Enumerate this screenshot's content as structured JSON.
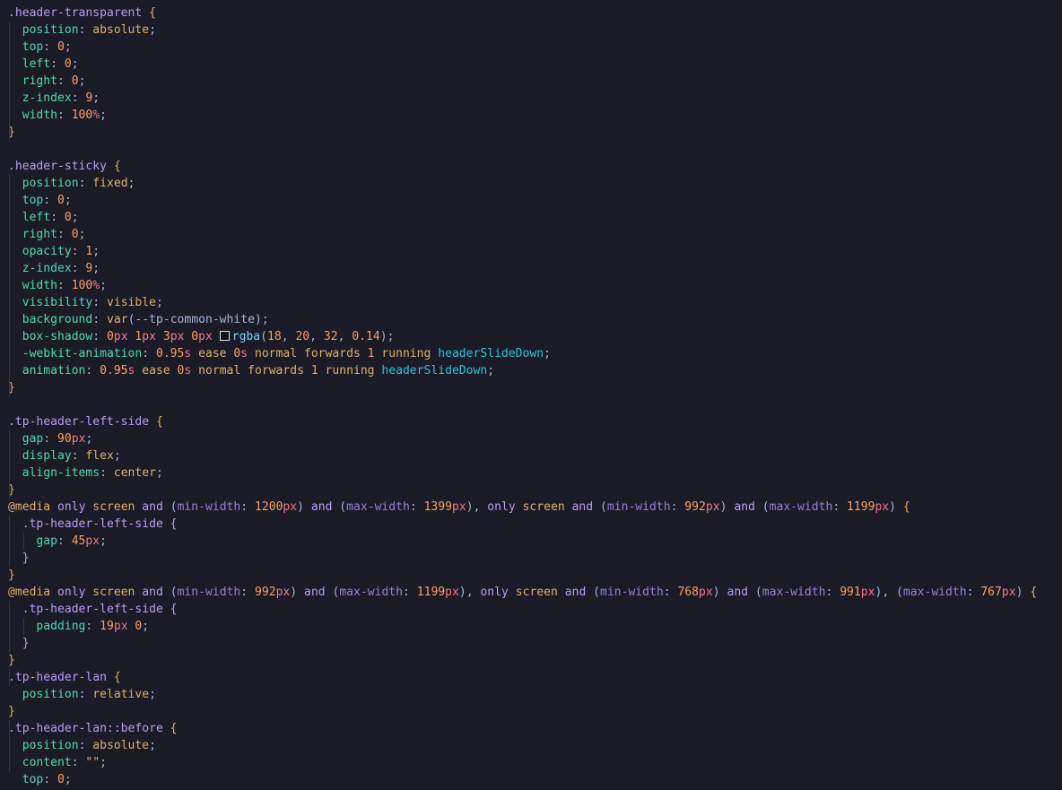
{
  "colors": {
    "background": "#1a1b26",
    "selector": "#bb9af7",
    "property": "#4fd6be",
    "punct": "#a9b1d6",
    "brace1": "#e0af68",
    "brace2": "#bb9af7",
    "keyword_value": "#ff9e64",
    "value": "#e0af68",
    "number": "#ff9e64",
    "unit": "#f7768e",
    "function": "#7dcfff",
    "at_rule": "#e0af68",
    "media_keyword": "#bb9af7",
    "media_feature": "#9d7cd8",
    "identifier": "#2ac3de",
    "string": "#e0af68",
    "indent_guide": "#33364a"
  },
  "code_lines": [
    [
      {
        "t": ".header-transparent",
        "c": "selector"
      },
      {
        "t": " ",
        "c": "punct"
      },
      {
        "t": "{",
        "c": "brace1"
      }
    ],
    [
      {
        "t": "  position",
        "c": "property"
      },
      {
        "t": ": ",
        "c": "punct"
      },
      {
        "t": "absolute",
        "c": "value"
      },
      {
        "t": ";",
        "c": "punct"
      }
    ],
    [
      {
        "t": "  top",
        "c": "property"
      },
      {
        "t": ": ",
        "c": "punct"
      },
      {
        "t": "0",
        "c": "number"
      },
      {
        "t": ";",
        "c": "punct"
      }
    ],
    [
      {
        "t": "  left",
        "c": "property"
      },
      {
        "t": ": ",
        "c": "punct"
      },
      {
        "t": "0",
        "c": "number"
      },
      {
        "t": ";",
        "c": "punct"
      }
    ],
    [
      {
        "t": "  right",
        "c": "property"
      },
      {
        "t": ": ",
        "c": "punct"
      },
      {
        "t": "0",
        "c": "number"
      },
      {
        "t": ";",
        "c": "punct"
      }
    ],
    [
      {
        "t": "  z-index",
        "c": "property"
      },
      {
        "t": ": ",
        "c": "punct"
      },
      {
        "t": "9",
        "c": "number"
      },
      {
        "t": ";",
        "c": "punct"
      }
    ],
    [
      {
        "t": "  width",
        "c": "property"
      },
      {
        "t": ": ",
        "c": "punct"
      },
      {
        "t": "100",
        "c": "number"
      },
      {
        "t": "%",
        "c": "unit"
      },
      {
        "t": ";",
        "c": "punct"
      }
    ],
    [
      {
        "t": "}",
        "c": "brace1"
      }
    ],
    [],
    [
      {
        "t": ".header-sticky",
        "c": "selector"
      },
      {
        "t": " ",
        "c": "punct"
      },
      {
        "t": "{",
        "c": "brace1"
      }
    ],
    [
      {
        "t": "  position",
        "c": "property"
      },
      {
        "t": ": ",
        "c": "punct"
      },
      {
        "t": "fixed",
        "c": "value"
      },
      {
        "t": ";",
        "c": "punct"
      }
    ],
    [
      {
        "t": "  top",
        "c": "property"
      },
      {
        "t": ": ",
        "c": "punct"
      },
      {
        "t": "0",
        "c": "number"
      },
      {
        "t": ";",
        "c": "punct"
      }
    ],
    [
      {
        "t": "  left",
        "c": "property"
      },
      {
        "t": ": ",
        "c": "punct"
      },
      {
        "t": "0",
        "c": "number"
      },
      {
        "t": ";",
        "c": "punct"
      }
    ],
    [
      {
        "t": "  right",
        "c": "property"
      },
      {
        "t": ": ",
        "c": "punct"
      },
      {
        "t": "0",
        "c": "number"
      },
      {
        "t": ";",
        "c": "punct"
      }
    ],
    [
      {
        "t": "  opacity",
        "c": "property"
      },
      {
        "t": ": ",
        "c": "punct"
      },
      {
        "t": "1",
        "c": "number"
      },
      {
        "t": ";",
        "c": "punct"
      }
    ],
    [
      {
        "t": "  z-index",
        "c": "property"
      },
      {
        "t": ": ",
        "c": "punct"
      },
      {
        "t": "9",
        "c": "number"
      },
      {
        "t": ";",
        "c": "punct"
      }
    ],
    [
      {
        "t": "  width",
        "c": "property"
      },
      {
        "t": ": ",
        "c": "punct"
      },
      {
        "t": "100",
        "c": "number"
      },
      {
        "t": "%",
        "c": "unit"
      },
      {
        "t": ";",
        "c": "punct"
      }
    ],
    [
      {
        "t": "  visibility",
        "c": "property"
      },
      {
        "t": ": ",
        "c": "punct"
      },
      {
        "t": "visible",
        "c": "value"
      },
      {
        "t": ";",
        "c": "punct"
      }
    ],
    [
      {
        "t": "  background",
        "c": "property"
      },
      {
        "t": ": ",
        "c": "punct"
      },
      {
        "t": "var",
        "c": "value"
      },
      {
        "t": "(",
        "c": "punct"
      },
      {
        "t": "--tp-common-white",
        "c": "punct"
      },
      {
        "t": ");",
        "c": "punct"
      }
    ],
    [
      {
        "t": "  box-shadow",
        "c": "property"
      },
      {
        "t": ": ",
        "c": "punct"
      },
      {
        "t": "0",
        "c": "number"
      },
      {
        "t": "px",
        "c": "unit"
      },
      {
        "t": " ",
        "c": "punct"
      },
      {
        "t": "1",
        "c": "number"
      },
      {
        "t": "px",
        "c": "unit"
      },
      {
        "t": " ",
        "c": "punct"
      },
      {
        "t": "3",
        "c": "number"
      },
      {
        "t": "px",
        "c": "unit"
      },
      {
        "t": " ",
        "c": "punct"
      },
      {
        "t": "0",
        "c": "number"
      },
      {
        "t": "px",
        "c": "unit"
      },
      {
        "t": " ",
        "c": "punct"
      },
      {
        "swatch": true
      },
      {
        "t": "rgba",
        "c": "function"
      },
      {
        "t": "(",
        "c": "punct"
      },
      {
        "t": "18",
        "c": "number"
      },
      {
        "t": ", ",
        "c": "punct"
      },
      {
        "t": "20",
        "c": "number"
      },
      {
        "t": ", ",
        "c": "punct"
      },
      {
        "t": "32",
        "c": "number"
      },
      {
        "t": ", ",
        "c": "punct"
      },
      {
        "t": "0.14",
        "c": "number"
      },
      {
        "t": ");",
        "c": "punct"
      }
    ],
    [
      {
        "t": "  -webkit-animation",
        "c": "property"
      },
      {
        "t": ": ",
        "c": "punct"
      },
      {
        "t": "0.95",
        "c": "number"
      },
      {
        "t": "s",
        "c": "unit"
      },
      {
        "t": " ",
        "c": "punct"
      },
      {
        "t": "ease",
        "c": "value"
      },
      {
        "t": " ",
        "c": "punct"
      },
      {
        "t": "0",
        "c": "number"
      },
      {
        "t": "s",
        "c": "unit"
      },
      {
        "t": " ",
        "c": "punct"
      },
      {
        "t": "normal",
        "c": "value"
      },
      {
        "t": " ",
        "c": "punct"
      },
      {
        "t": "forwards",
        "c": "value"
      },
      {
        "t": " ",
        "c": "punct"
      },
      {
        "t": "1",
        "c": "number"
      },
      {
        "t": " ",
        "c": "punct"
      },
      {
        "t": "running",
        "c": "value"
      },
      {
        "t": " ",
        "c": "punct"
      },
      {
        "t": "headerSlideDown",
        "c": "identifier"
      },
      {
        "t": ";",
        "c": "punct"
      }
    ],
    [
      {
        "t": "  animation",
        "c": "property"
      },
      {
        "t": ": ",
        "c": "punct"
      },
      {
        "t": "0.95",
        "c": "number"
      },
      {
        "t": "s",
        "c": "unit"
      },
      {
        "t": " ",
        "c": "punct"
      },
      {
        "t": "ease",
        "c": "value"
      },
      {
        "t": " ",
        "c": "punct"
      },
      {
        "t": "0",
        "c": "number"
      },
      {
        "t": "s",
        "c": "unit"
      },
      {
        "t": " ",
        "c": "punct"
      },
      {
        "t": "normal",
        "c": "value"
      },
      {
        "t": " ",
        "c": "punct"
      },
      {
        "t": "forwards",
        "c": "value"
      },
      {
        "t": " ",
        "c": "punct"
      },
      {
        "t": "1",
        "c": "number"
      },
      {
        "t": " ",
        "c": "punct"
      },
      {
        "t": "running",
        "c": "value"
      },
      {
        "t": " ",
        "c": "punct"
      },
      {
        "t": "headerSlideDown",
        "c": "identifier"
      },
      {
        "t": ";",
        "c": "punct"
      }
    ],
    [
      {
        "t": "}",
        "c": "brace1"
      }
    ],
    [],
    [
      {
        "t": ".tp-header-left-side",
        "c": "selector"
      },
      {
        "t": " ",
        "c": "punct"
      },
      {
        "t": "{",
        "c": "brace1"
      }
    ],
    [
      {
        "t": "  gap",
        "c": "property"
      },
      {
        "t": ": ",
        "c": "punct"
      },
      {
        "t": "90",
        "c": "number"
      },
      {
        "t": "px",
        "c": "unit"
      },
      {
        "t": ";",
        "c": "punct"
      }
    ],
    [
      {
        "t": "  display",
        "c": "property"
      },
      {
        "t": ": ",
        "c": "punct"
      },
      {
        "t": "flex",
        "c": "value"
      },
      {
        "t": ";",
        "c": "punct"
      }
    ],
    [
      {
        "t": "  align-items",
        "c": "property"
      },
      {
        "t": ": ",
        "c": "punct"
      },
      {
        "t": "center",
        "c": "value"
      },
      {
        "t": ";",
        "c": "punct"
      }
    ],
    [
      {
        "t": "}",
        "c": "brace1"
      }
    ],
    [
      {
        "t": "@media",
        "c": "at_rule"
      },
      {
        "t": " ",
        "c": "punct"
      },
      {
        "t": "only",
        "c": "media_keyword"
      },
      {
        "t": " ",
        "c": "punct"
      },
      {
        "t": "screen",
        "c": "value"
      },
      {
        "t": " ",
        "c": "punct"
      },
      {
        "t": "and",
        "c": "media_keyword"
      },
      {
        "t": " (",
        "c": "punct"
      },
      {
        "t": "min-width",
        "c": "media_feature"
      },
      {
        "t": ": ",
        "c": "punct"
      },
      {
        "t": "1200",
        "c": "number"
      },
      {
        "t": "px",
        "c": "unit"
      },
      {
        "t": ") ",
        "c": "punct"
      },
      {
        "t": "and",
        "c": "media_keyword"
      },
      {
        "t": " (",
        "c": "punct"
      },
      {
        "t": "max-width",
        "c": "media_feature"
      },
      {
        "t": ": ",
        "c": "punct"
      },
      {
        "t": "1399",
        "c": "number"
      },
      {
        "t": "px",
        "c": "unit"
      },
      {
        "t": "), ",
        "c": "punct"
      },
      {
        "t": "only",
        "c": "media_keyword"
      },
      {
        "t": " ",
        "c": "punct"
      },
      {
        "t": "screen",
        "c": "value"
      },
      {
        "t": " ",
        "c": "punct"
      },
      {
        "t": "and",
        "c": "media_keyword"
      },
      {
        "t": " (",
        "c": "punct"
      },
      {
        "t": "min-width",
        "c": "media_feature"
      },
      {
        "t": ": ",
        "c": "punct"
      },
      {
        "t": "992",
        "c": "number"
      },
      {
        "t": "px",
        "c": "unit"
      },
      {
        "t": ") ",
        "c": "punct"
      },
      {
        "t": "and",
        "c": "media_keyword"
      },
      {
        "t": " (",
        "c": "punct"
      },
      {
        "t": "max-width",
        "c": "media_feature"
      },
      {
        "t": ": ",
        "c": "punct"
      },
      {
        "t": "1199",
        "c": "number"
      },
      {
        "t": "px",
        "c": "unit"
      },
      {
        "t": ") ",
        "c": "punct"
      },
      {
        "t": "{",
        "c": "brace1"
      }
    ],
    [
      {
        "t": "  .tp-header-left-side",
        "c": "selector"
      },
      {
        "t": " ",
        "c": "punct"
      },
      {
        "t": "{",
        "c": "brace2"
      }
    ],
    [
      {
        "t": "    gap",
        "c": "property"
      },
      {
        "t": ": ",
        "c": "punct"
      },
      {
        "t": "45",
        "c": "number"
      },
      {
        "t": "px",
        "c": "unit"
      },
      {
        "t": ";",
        "c": "punct"
      }
    ],
    [
      {
        "t": "  }",
        "c": "brace2"
      }
    ],
    [
      {
        "t": "}",
        "c": "brace1"
      }
    ],
    [
      {
        "t": "@media",
        "c": "at_rule"
      },
      {
        "t": " ",
        "c": "punct"
      },
      {
        "t": "only",
        "c": "media_keyword"
      },
      {
        "t": " ",
        "c": "punct"
      },
      {
        "t": "screen",
        "c": "value"
      },
      {
        "t": " ",
        "c": "punct"
      },
      {
        "t": "and",
        "c": "media_keyword"
      },
      {
        "t": " (",
        "c": "punct"
      },
      {
        "t": "min-width",
        "c": "media_feature"
      },
      {
        "t": ": ",
        "c": "punct"
      },
      {
        "t": "992",
        "c": "number"
      },
      {
        "t": "px",
        "c": "unit"
      },
      {
        "t": ") ",
        "c": "punct"
      },
      {
        "t": "and",
        "c": "media_keyword"
      },
      {
        "t": " (",
        "c": "punct"
      },
      {
        "t": "max-width",
        "c": "media_feature"
      },
      {
        "t": ": ",
        "c": "punct"
      },
      {
        "t": "1199",
        "c": "number"
      },
      {
        "t": "px",
        "c": "unit"
      },
      {
        "t": "), ",
        "c": "punct"
      },
      {
        "t": "only",
        "c": "media_keyword"
      },
      {
        "t": " ",
        "c": "punct"
      },
      {
        "t": "screen",
        "c": "value"
      },
      {
        "t": " ",
        "c": "punct"
      },
      {
        "t": "and",
        "c": "media_keyword"
      },
      {
        "t": " (",
        "c": "punct"
      },
      {
        "t": "min-width",
        "c": "media_feature"
      },
      {
        "t": ": ",
        "c": "punct"
      },
      {
        "t": "768",
        "c": "number"
      },
      {
        "t": "px",
        "c": "unit"
      },
      {
        "t": ") ",
        "c": "punct"
      },
      {
        "t": "and",
        "c": "media_keyword"
      },
      {
        "t": " (",
        "c": "punct"
      },
      {
        "t": "max-width",
        "c": "media_feature"
      },
      {
        "t": ": ",
        "c": "punct"
      },
      {
        "t": "991",
        "c": "number"
      },
      {
        "t": "px",
        "c": "unit"
      },
      {
        "t": "), (",
        "c": "punct"
      },
      {
        "t": "max-width",
        "c": "media_feature"
      },
      {
        "t": ": ",
        "c": "punct"
      },
      {
        "t": "767",
        "c": "number"
      },
      {
        "t": "px",
        "c": "unit"
      },
      {
        "t": ") ",
        "c": "punct"
      },
      {
        "t": "{",
        "c": "brace1"
      }
    ],
    [
      {
        "t": "  .tp-header-left-side",
        "c": "selector"
      },
      {
        "t": " ",
        "c": "punct"
      },
      {
        "t": "{",
        "c": "brace2"
      }
    ],
    [
      {
        "t": "    padding",
        "c": "property"
      },
      {
        "t": ": ",
        "c": "punct"
      },
      {
        "t": "19",
        "c": "number"
      },
      {
        "t": "px",
        "c": "unit"
      },
      {
        "t": " ",
        "c": "punct"
      },
      {
        "t": "0",
        "c": "number"
      },
      {
        "t": ";",
        "c": "punct"
      }
    ],
    [
      {
        "t": "  }",
        "c": "brace2"
      }
    ],
    [
      {
        "t": "}",
        "c": "brace1"
      }
    ],
    [
      {
        "t": ".tp-header-lan",
        "c": "selector"
      },
      {
        "t": " ",
        "c": "punct"
      },
      {
        "t": "{",
        "c": "brace1"
      }
    ],
    [
      {
        "t": "  position",
        "c": "property"
      },
      {
        "t": ": ",
        "c": "punct"
      },
      {
        "t": "relative",
        "c": "value"
      },
      {
        "t": ";",
        "c": "punct"
      }
    ],
    [
      {
        "t": "}",
        "c": "brace1"
      }
    ],
    [
      {
        "t": ".tp-header-lan::before",
        "c": "selector"
      },
      {
        "t": " ",
        "c": "punct"
      },
      {
        "t": "{",
        "c": "brace1"
      }
    ],
    [
      {
        "t": "  position",
        "c": "property"
      },
      {
        "t": ": ",
        "c": "punct"
      },
      {
        "t": "absolute",
        "c": "value"
      },
      {
        "t": ";",
        "c": "punct"
      }
    ],
    [
      {
        "t": "  content",
        "c": "property"
      },
      {
        "t": ": ",
        "c": "punct"
      },
      {
        "t": "\"\"",
        "c": "string"
      },
      {
        "t": ";",
        "c": "punct"
      }
    ],
    [
      {
        "t": "  top",
        "c": "property"
      },
      {
        "t": ": ",
        "c": "punct"
      },
      {
        "t": "0",
        "c": "number"
      },
      {
        "t": ";",
        "c": "punct"
      }
    ]
  ]
}
